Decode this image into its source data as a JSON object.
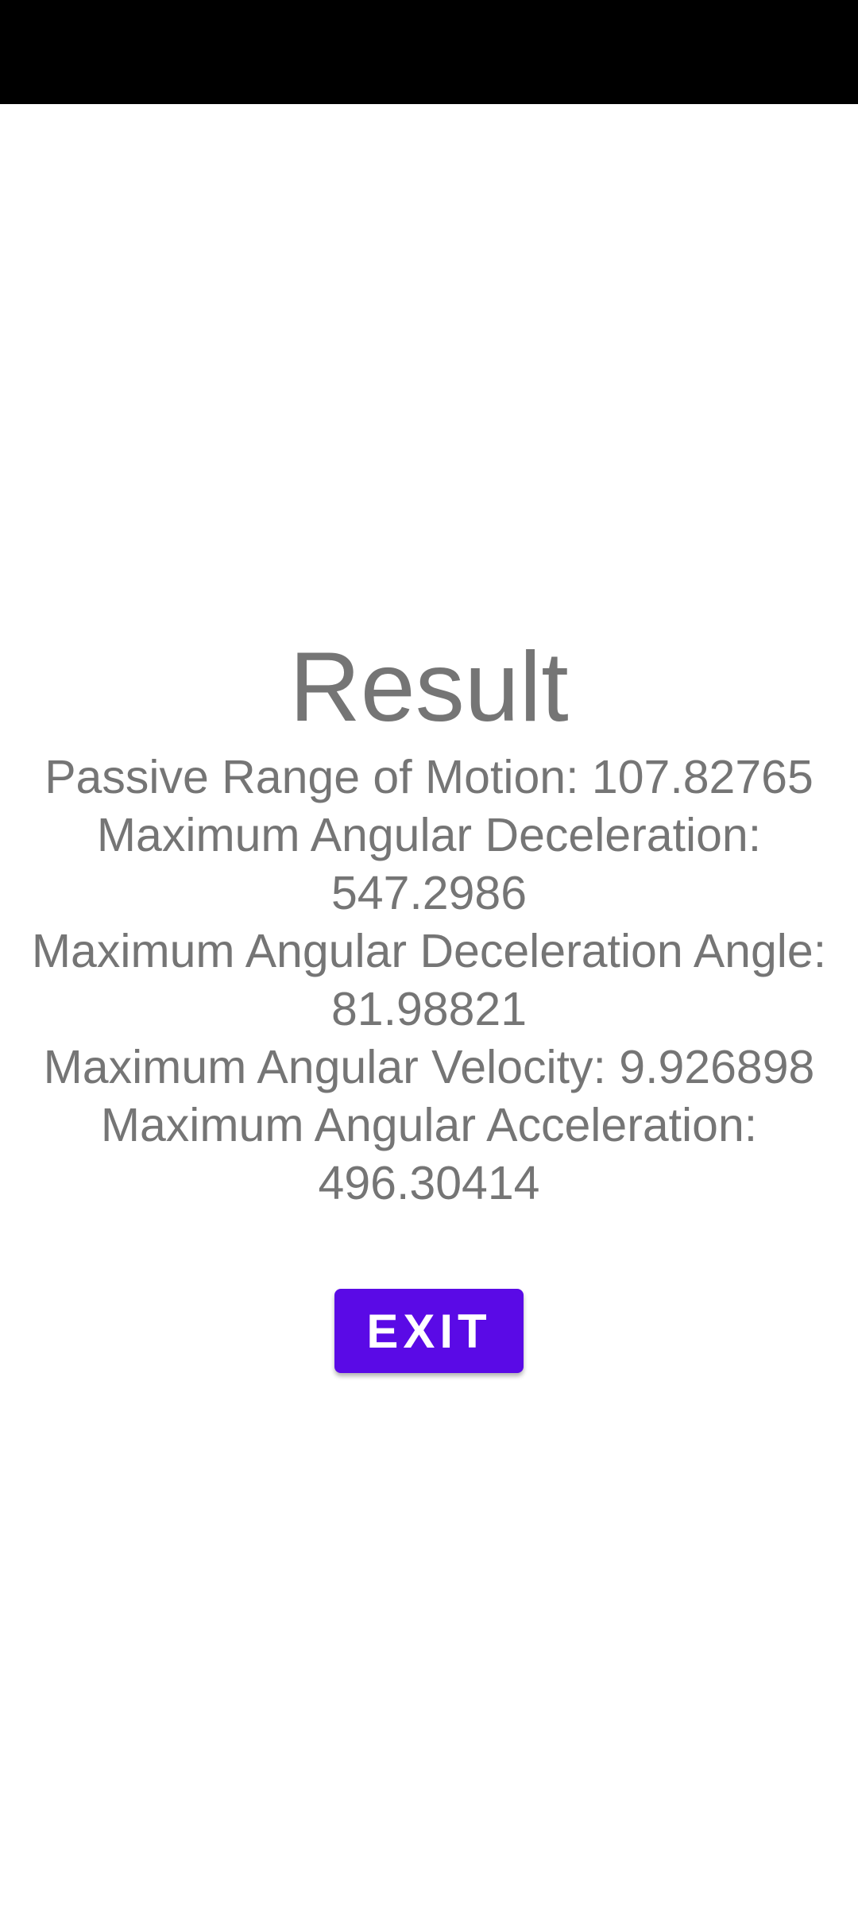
{
  "header": {
    "title": "Result"
  },
  "results": [
    {
      "text": "Passive Range of Motion: 107.82765"
    },
    {
      "text": "Maximum Angular Deceleration: 547.2986"
    },
    {
      "text": "Maximum Angular Deceleration Angle: 81.98821"
    },
    {
      "text": "Maximum Angular Velocity: 9.926898"
    },
    {
      "text": "Maximum Angular Acceleration: 496.30414"
    }
  ],
  "actions": {
    "exit_label": "EXIT"
  },
  "colors": {
    "status_bar": "#000000",
    "text": "#757575",
    "button": "#5a0ae6",
    "button_text": "#ffffff",
    "background": "#ffffff"
  }
}
